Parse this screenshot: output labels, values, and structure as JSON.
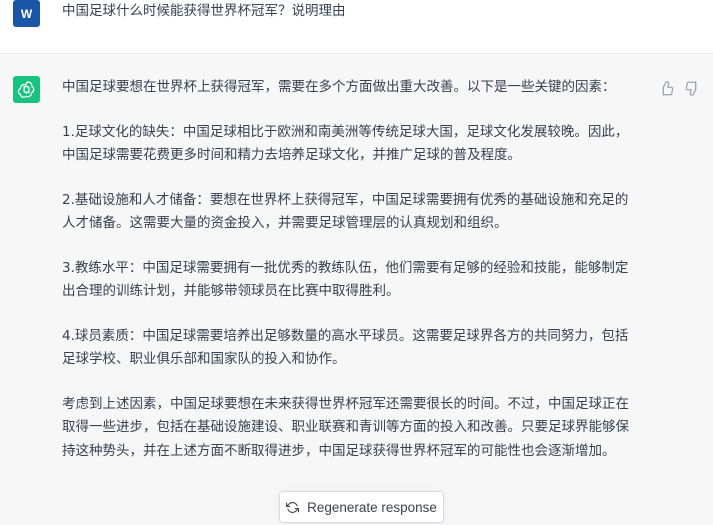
{
  "user": {
    "avatar_initial": "W",
    "message": "中国足球什么时候能获得世界杯冠军？说明理由"
  },
  "assistant": {
    "paragraphs": [
      "中国足球要想在世界杯上获得冠军，需要在多个方面做出重大改善。以下是一些关键的因素：",
      "1.足球文化的缺失：中国足球相比于欧洲和南美洲等传统足球大国，足球文化发展较晚。因此，中国足球需要花费更多时间和精力去培养足球文化，并推广足球的普及程度。",
      "2.基础设施和人才储备：要想在世界杯上获得冠军，中国足球需要拥有优秀的基础设施和充足的人才储备。这需要大量的资金投入，并需要足球管理层的认真规划和组织。",
      "3.教练水平：中国足球需要拥有一批优秀的教练队伍，他们需要有足够的经验和技能，能够制定出合理的训练计划，并能够带领球员在比赛中取得胜利。",
      "4.球员素质：中国足球需要培养出足够数量的高水平球员。这需要足球界各方的共同努力，包括足球学校、职业俱乐部和国家队的投入和协作。",
      "考虑到上述因素，中国足球要想在未来获得世界杯冠军还需要很长的时间。不过，中国足球正在取得一些进步，包括在基础设施建设、职业联赛和青训等方面的投入和改善。只要足球界能够保持这种势头，并在上述方面不断取得进步，中国足球获得世界杯冠军的可能性也会逐渐增加。"
    ]
  },
  "controls": {
    "regenerate_label": "Regenerate response",
    "thumb_up_icon": "thumb-up-icon",
    "thumb_down_icon": "thumb-down-icon",
    "refresh_icon": "refresh-icon"
  },
  "colors": {
    "user_avatar": "#1a55a8",
    "assistant_avatar": "#19c37d",
    "assistant_bg": "#f7f7f8"
  }
}
